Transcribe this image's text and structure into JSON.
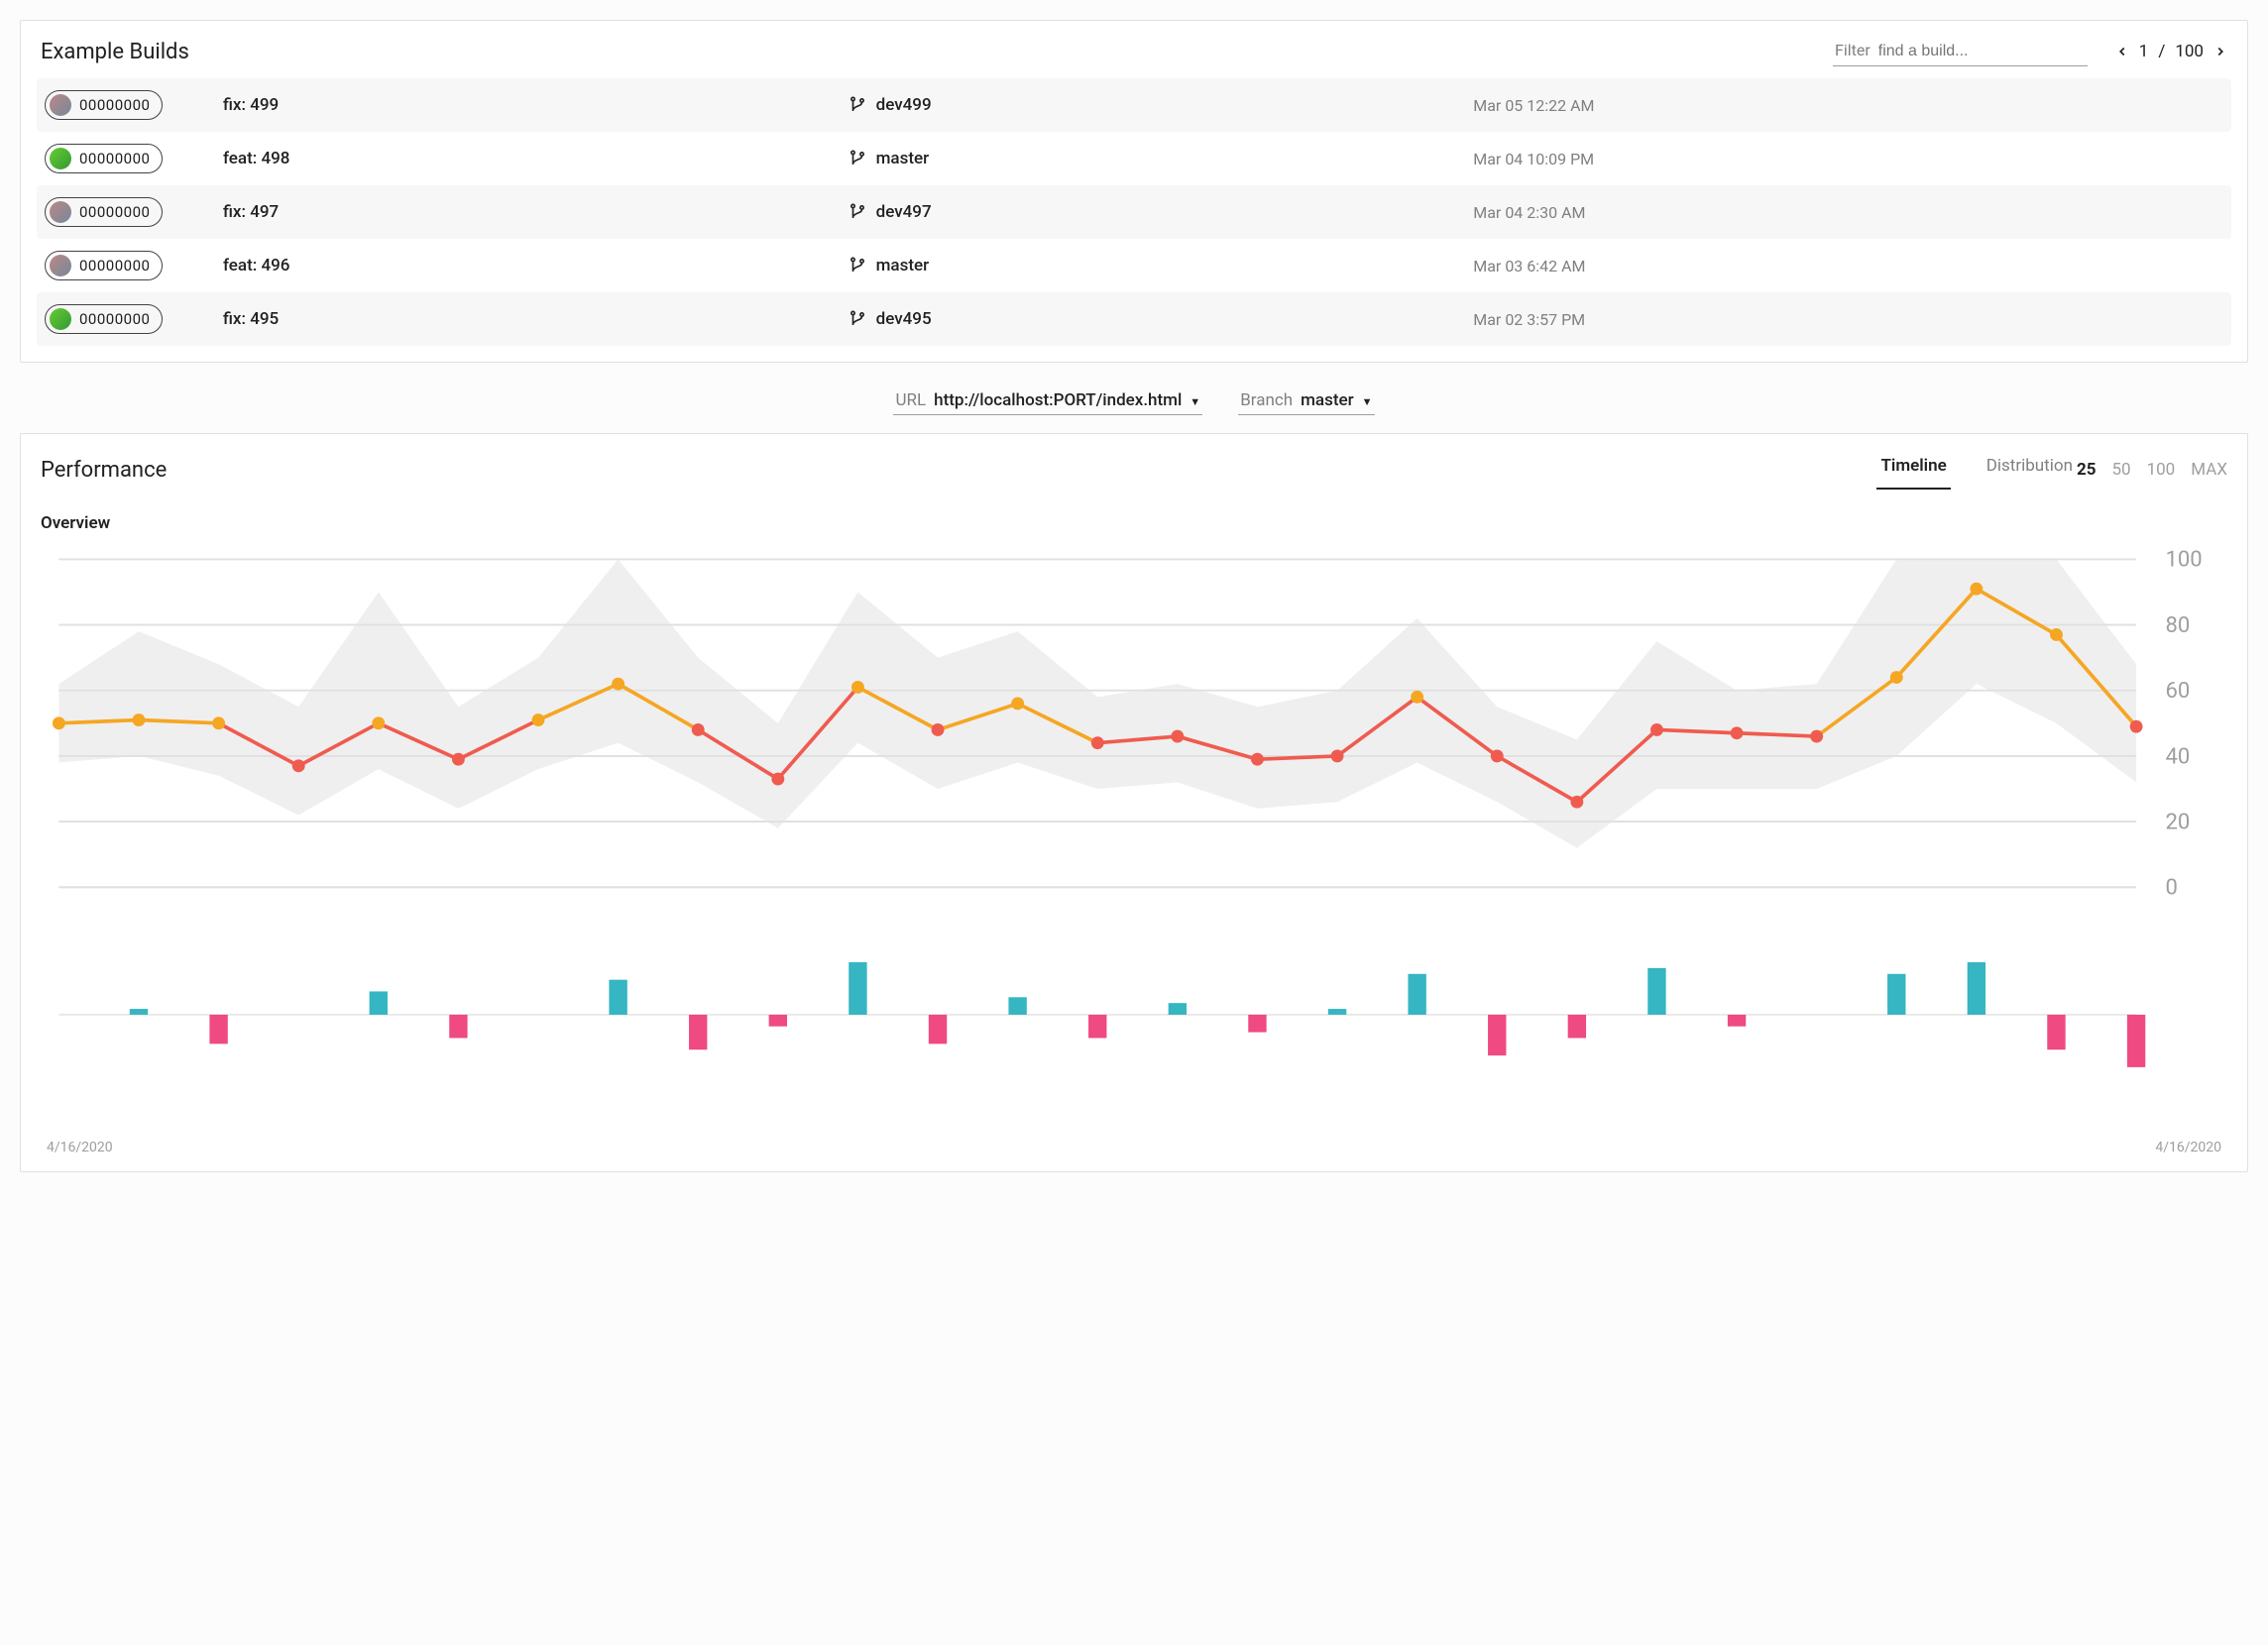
{
  "builds_panel": {
    "title": "Example Builds",
    "filter_label": "Filter",
    "filter_placeholder": "find a build...",
    "page_current": "1",
    "page_sep": "/",
    "page_total": "100",
    "rows": [
      {
        "hash": "00000000",
        "avatar": "a",
        "message": "fix: 499",
        "branch": "dev499",
        "timestamp": "Mar 05 12:22 AM"
      },
      {
        "hash": "00000000",
        "avatar": "b",
        "message": "feat: 498",
        "branch": "master",
        "timestamp": "Mar 04 10:09 PM"
      },
      {
        "hash": "00000000",
        "avatar": "a",
        "message": "fix: 497",
        "branch": "dev497",
        "timestamp": "Mar 04 2:30 AM"
      },
      {
        "hash": "00000000",
        "avatar": "a",
        "message": "feat: 496",
        "branch": "master",
        "timestamp": "Mar 03 6:42 AM"
      },
      {
        "hash": "00000000",
        "avatar": "b",
        "message": "fix: 495",
        "branch": "dev495",
        "timestamp": "Mar 02 3:57 PM"
      }
    ]
  },
  "selectors": {
    "url_label": "URL",
    "url_value": "http://localhost:PORT/index.html",
    "branch_label": "Branch",
    "branch_value": "master"
  },
  "perf_panel": {
    "title": "Performance",
    "tabs": {
      "timeline": "Timeline",
      "distribution": "Distribution"
    },
    "range": {
      "r25": "25",
      "r50": "50",
      "r100": "100",
      "rmax": "MAX"
    },
    "overview_label": "Overview",
    "axis_start": "4/16/2020",
    "axis_end": "4/16/2020"
  },
  "chart_data": {
    "type": "line",
    "ylim": [
      0,
      100
    ],
    "yticks": [
      0,
      20,
      40,
      60,
      80,
      100
    ],
    "x": [
      0,
      1,
      2,
      3,
      4,
      5,
      6,
      7,
      8,
      9,
      10,
      11,
      12,
      13,
      14,
      15,
      16,
      17,
      18,
      19,
      20,
      21,
      22,
      23,
      24
    ],
    "series": [
      {
        "name": "score",
        "values": [
          50,
          51,
          50,
          37,
          50,
          39,
          51,
          62,
          48,
          33,
          61,
          48,
          56,
          44,
          46,
          39,
          40,
          58,
          40,
          26,
          48,
          47,
          46,
          64,
          91,
          77,
          49
        ]
      }
    ],
    "band_upper": [
      62,
      78,
      68,
      55,
      90,
      55,
      70,
      100,
      70,
      50,
      90,
      70,
      78,
      58,
      62,
      55,
      60,
      82,
      55,
      45,
      75,
      60,
      62,
      100,
      100,
      100,
      68
    ],
    "band_lower": [
      38,
      40,
      34,
      22,
      36,
      24,
      36,
      44,
      32,
      18,
      44,
      30,
      38,
      30,
      32,
      24,
      26,
      38,
      26,
      12,
      30,
      30,
      30,
      40,
      62,
      50,
      32
    ],
    "perf_color_thresholds": {
      "red": "#f05b4f",
      "orange": "#f5a623"
    },
    "diff_bars": {
      "type": "bar",
      "values": [
        0,
        1,
        -5,
        0,
        4,
        -4,
        0,
        6,
        -6,
        -2,
        9,
        -5,
        3,
        -4,
        2,
        -3,
        1,
        7,
        -7,
        -4,
        8,
        -2,
        0,
        7,
        9,
        -6,
        -9
      ],
      "colors": {
        "pos": "#35b6c2",
        "neg": "#ef4a81"
      }
    }
  }
}
